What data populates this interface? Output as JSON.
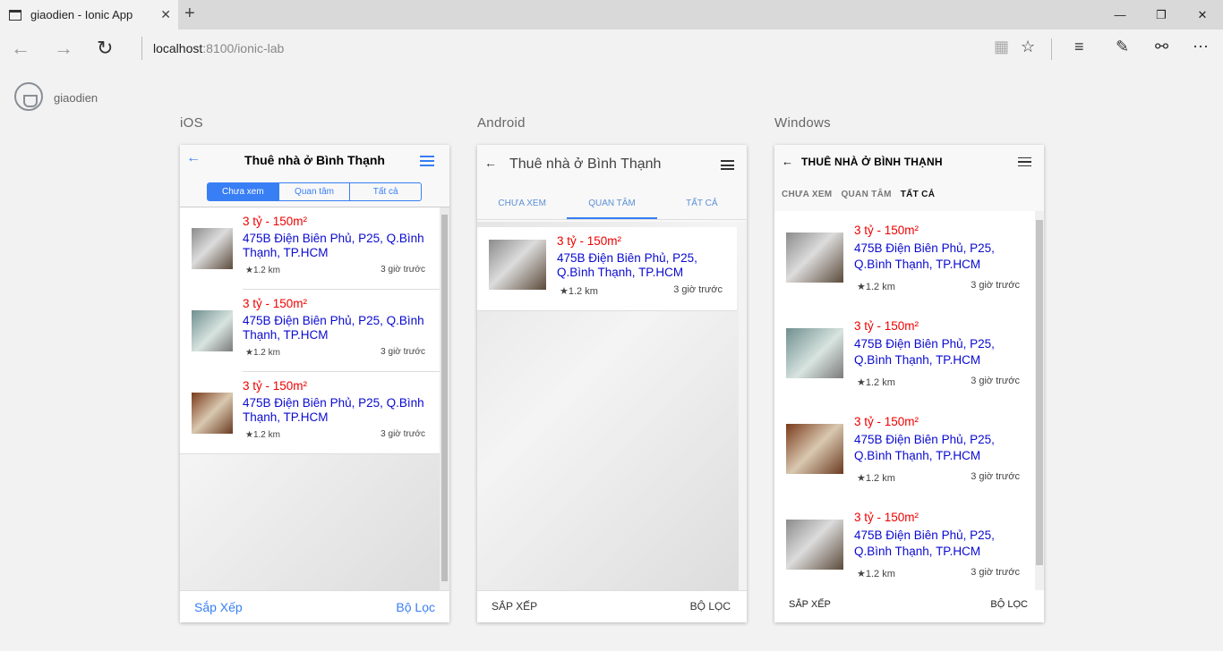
{
  "browser": {
    "tab_title": "giaodien - Ionic App",
    "url_host": "localhost",
    "url_path": ":8100/ionic-lab"
  },
  "lab": {
    "app_name": "giaodien",
    "platforms": [
      "iOS",
      "Android",
      "Windows"
    ]
  },
  "ios": {
    "title": "Thuê nhà ở Bình Thạnh",
    "segments": [
      "Chưa xem",
      "Quan tâm",
      "Tất cả"
    ],
    "active_segment": 0,
    "items": [
      {
        "price": "3 tỷ - 150m²",
        "address": "475B Điện Biên Phủ, P25, Q.Bình Thạnh, TP.HCM",
        "distance": "1.2 km",
        "time": "3 giờ trước"
      },
      {
        "price": "3 tỷ - 150m²",
        "address": "475B Điện Biên Phủ, P25, Q.Bình Thạnh, TP.HCM",
        "distance": "1.2 km",
        "time": "3 giờ trước"
      },
      {
        "price": "3 tỷ - 150m²",
        "address": "475B Điện Biên Phủ, P25, Q.Bình Thạnh, TP.HCM",
        "distance": "1.2 km",
        "time": "3 giờ trước"
      }
    ],
    "sort_label": "Sắp Xếp",
    "filter_label": "Bộ Lọc"
  },
  "android": {
    "title": "Thuê nhà ở Bình Thạnh",
    "tabs": [
      "CHƯA XEM",
      "QUAN TÂM",
      "TẤT CẢ"
    ],
    "active_tab": 1,
    "items": [
      {
        "price": "3 tỷ - 150m²",
        "address": "475B Điện Biên Phủ, P25, Q.Bình Thạnh, TP.HCM",
        "distance": "1.2 km",
        "time": "3 giờ trước"
      }
    ],
    "sort_label": "SẮP XẾP",
    "filter_label": "BỘ LỌC"
  },
  "windows": {
    "title": "THUÊ NHÀ Ở BÌNH THẠNH",
    "tabs": [
      "CHƯA XEM",
      "QUAN TÂM",
      "TẤT CẢ"
    ],
    "active_tab": 2,
    "items": [
      {
        "price": "3 tỷ - 150m²",
        "address": "475B Điện Biên Phủ, P25, Q.Bình Thạnh, TP.HCM",
        "distance": "1.2 km",
        "time": "3 giờ trước"
      },
      {
        "price": "3 tỷ - 150m²",
        "address": "475B Điện Biên Phủ, P25, Q.Bình Thạnh, TP.HCM",
        "distance": "1.2 km",
        "time": "3 giờ trước"
      },
      {
        "price": "3 tỷ - 150m²",
        "address": "475B Điện Biên Phủ, P25, Q.Bình Thạnh, TP.HCM",
        "distance": "1.2 km",
        "time": "3 giờ trước"
      },
      {
        "price": "3 tỷ - 150m²",
        "address": "475B Điện Biên Phủ, P25, Q.Bình Thạnh, TP.HCM",
        "distance": "1.2 km",
        "time": "3 giờ trước"
      }
    ],
    "sort_label": "SẮP XẾP",
    "filter_label": "BỘ LỌC"
  },
  "colors": {
    "ios_accent": "#387ef5",
    "price": "#ee0000",
    "address": "#0a0ad0"
  }
}
